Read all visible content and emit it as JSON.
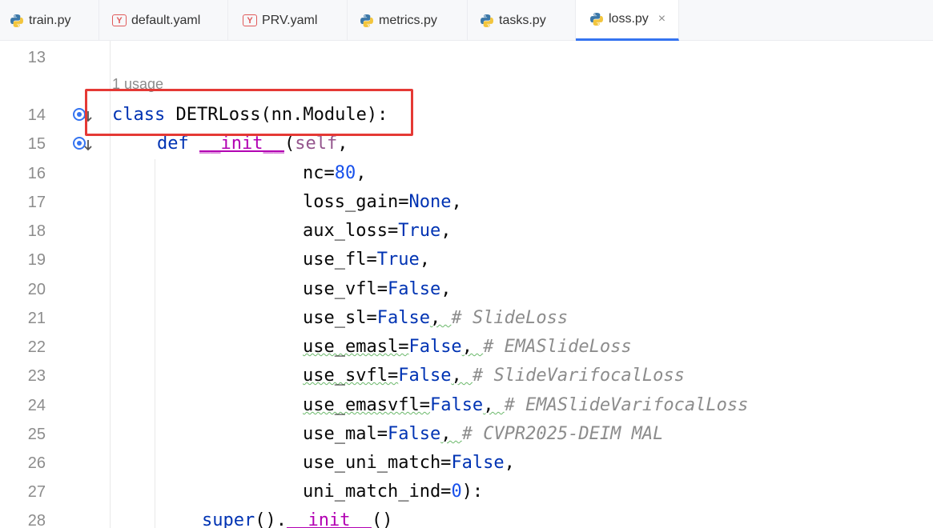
{
  "tabs": [
    {
      "label": "train.py",
      "icon": "python-icon",
      "active": false
    },
    {
      "label": "default.yaml",
      "icon": "yaml-icon",
      "active": false
    },
    {
      "label": "PRV.yaml",
      "icon": "yaml-icon",
      "active": false
    },
    {
      "label": "metrics.py",
      "icon": "python-icon",
      "active": false
    },
    {
      "label": "tasks.py",
      "icon": "python-icon",
      "active": false
    },
    {
      "label": "loss.py",
      "icon": "python-icon",
      "active": true
    }
  ],
  "yaml_icon_letter": "Y",
  "close_glyph": "×",
  "inlay_hint": "1 usage",
  "colors": {
    "keyword": "#0033b3",
    "number": "#1750eb",
    "comment": "#8c8c8c",
    "highlight_box": "#e53935",
    "active_tab_underline": "#3574f0"
  },
  "lines": [
    {
      "num": "13"
    },
    {
      "num": "14",
      "t": {
        "kw": "class",
        "name": " DETRLoss(nn.Module):"
      }
    },
    {
      "num": "15",
      "t": {
        "kw": "def",
        "sp": " ",
        "fn": "__init__",
        "p": "(",
        "self": "self",
        "c": ","
      }
    },
    {
      "num": "16",
      "t": {
        "a": "nc=",
        "v": "80",
        "e": ","
      }
    },
    {
      "num": "17",
      "t": {
        "a": "loss_gain=",
        "v": "None",
        "e": ","
      }
    },
    {
      "num": "18",
      "t": {
        "a": "aux_loss=",
        "v": "True",
        "e": ","
      }
    },
    {
      "num": "19",
      "t": {
        "a": "use_fl=",
        "v": "True",
        "e": ","
      }
    },
    {
      "num": "20",
      "t": {
        "a": "use_vfl=",
        "v": "False",
        "e": ","
      }
    },
    {
      "num": "21",
      "t": {
        "a": "use_sl=",
        "v": "False",
        "e": ", ",
        "cm": "# SlideLoss"
      }
    },
    {
      "num": "22",
      "t": {
        "a": "use_emasl=",
        "v": "False",
        "e": ", ",
        "cm": "# EMASlideLoss"
      }
    },
    {
      "num": "23",
      "t": {
        "a": "use_svfl=",
        "v": "False",
        "e": ", ",
        "cm": "# SlideVarifocalLoss"
      }
    },
    {
      "num": "24",
      "t": {
        "a": "use_emasvfl=",
        "v": "False",
        "e": ", ",
        "cm": "# EMASlideVarifocalLoss"
      }
    },
    {
      "num": "25",
      "t": {
        "a": "use_mal=",
        "v": "False",
        "e": ", ",
        "cm": "# CVPR2025-DEIM MAL"
      }
    },
    {
      "num": "26",
      "t": {
        "a": "use_uni_match=",
        "v": "False",
        "e": ","
      }
    },
    {
      "num": "27",
      "t": {
        "a": "uni_match_ind=",
        "v": "0",
        "e": "):"
      }
    },
    {
      "num": "28",
      "t": {
        "s": "super",
        "r": "().",
        "m": "__init__",
        "z": "()"
      }
    }
  ]
}
